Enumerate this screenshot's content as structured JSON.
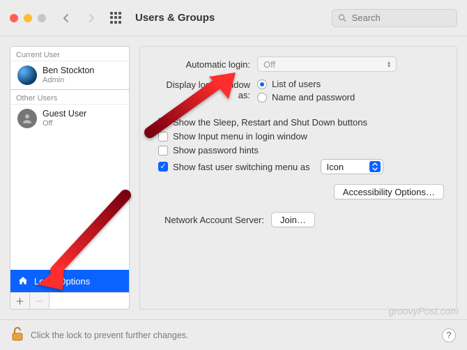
{
  "header": {
    "title": "Users & Groups",
    "search_placeholder": "Search"
  },
  "sidebar": {
    "current_label": "Current User",
    "other_label": "Other Users",
    "current_user": {
      "name": "Ben Stockton",
      "role": "Admin"
    },
    "other_user": {
      "name": "Guest User",
      "role": "Off"
    },
    "login_options_label": "Login Options"
  },
  "main": {
    "auto_login_label": "Automatic login:",
    "auto_login_value": "Off",
    "display_label": "Display login window as:",
    "radio_list": "List of users",
    "radio_namepw": "Name and password",
    "chk_sleep": "Show the Sleep, Restart and Shut Down buttons",
    "chk_input": "Show Input menu in login window",
    "chk_hints": "Show password hints",
    "chk_fast": "Show fast user switching menu as",
    "fast_value": "Icon",
    "acc_button": "Accessibility Options…",
    "nas_label": "Network Account Server:",
    "join_button": "Join…"
  },
  "footer": {
    "lock_text": "Click the lock to prevent further changes."
  },
  "watermark": "groovyPost.com"
}
